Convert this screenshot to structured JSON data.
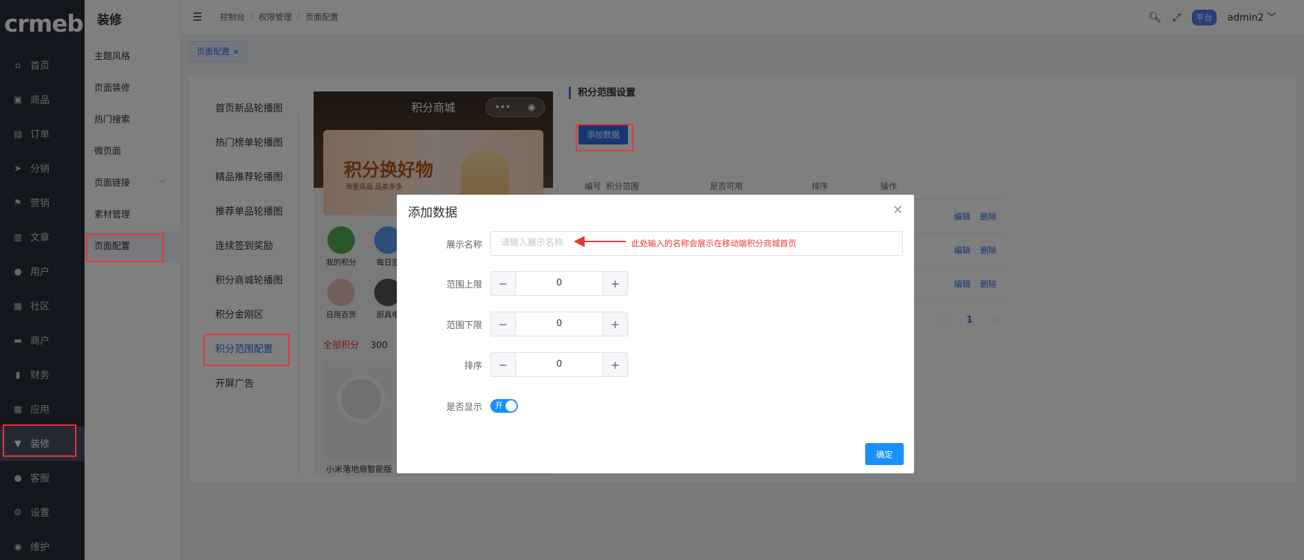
{
  "logo": "crmeb",
  "sidebar": {
    "items": [
      {
        "label": "首页",
        "icon": "home-icon"
      },
      {
        "label": "商品",
        "icon": "bag-icon"
      },
      {
        "label": "订单",
        "icon": "clipboard-icon"
      },
      {
        "label": "分销",
        "icon": "send-icon"
      },
      {
        "label": "营销",
        "icon": "flag-icon"
      },
      {
        "label": "文章",
        "icon": "chart-bars-icon"
      },
      {
        "label": "用户",
        "icon": "user-icon"
      },
      {
        "label": "社区",
        "icon": "briefcase-icon"
      },
      {
        "label": "商户",
        "icon": "store-icon"
      },
      {
        "label": "财务",
        "icon": "bar-chart-icon"
      },
      {
        "label": "应用",
        "icon": "grid-icon"
      },
      {
        "label": "装修",
        "icon": "brush-icon"
      },
      {
        "label": "客服",
        "icon": "headset-icon"
      },
      {
        "label": "设置",
        "icon": "gear-icon"
      },
      {
        "label": "维护",
        "icon": "shield-icon"
      }
    ]
  },
  "subside": {
    "title": "装修",
    "items": [
      "主题风格",
      "页面装修",
      "热门搜索",
      "微页面",
      "页面链接",
      "素材管理",
      "页面配置"
    ]
  },
  "header": {
    "breadcrumb": [
      "控制台",
      "权限管理",
      "页面配置"
    ],
    "platform": "平台",
    "user": "admin2"
  },
  "tab": {
    "label": "页面配置"
  },
  "config_menu": [
    "首页新品轮播图",
    "热门榜单轮播图",
    "精品推荐轮播图",
    "推荐单品轮播图",
    "连续签到奖励",
    "积分商城轮播图",
    "积分金刚区",
    "积分范围配置",
    "开屏广告"
  ],
  "phone": {
    "title": "积分商城",
    "banner_title": "积分换好物",
    "banner_sub": "海量商品  品类多多",
    "quick": [
      "我的积分",
      "每日签",
      "日用百货",
      "厨具电"
    ],
    "segment": [
      "全部积分",
      "300"
    ],
    "product_name": "小米落地扇智能版"
  },
  "panel": {
    "title": "积分范围设置",
    "add_button": "添加数据",
    "columns": [
      "编号",
      "积分范围",
      "是否可用",
      "排序",
      "操作"
    ],
    "row_ops": [
      "编辑",
      "删除"
    ],
    "page": "1"
  },
  "dialog": {
    "title": "添加数据",
    "fields": {
      "name_label": "展示名称",
      "name_placeholder": "请输入展示名称",
      "upper_label": "范围上限",
      "upper_value": "0",
      "lower_label": "范围下限",
      "lower_value": "0",
      "sort_label": "排序",
      "sort_value": "0",
      "show_label": "是否显示",
      "switch_text": "开"
    },
    "hint": "此处输入的名称会展示在移动端积分商城首页",
    "confirm": "确定"
  }
}
